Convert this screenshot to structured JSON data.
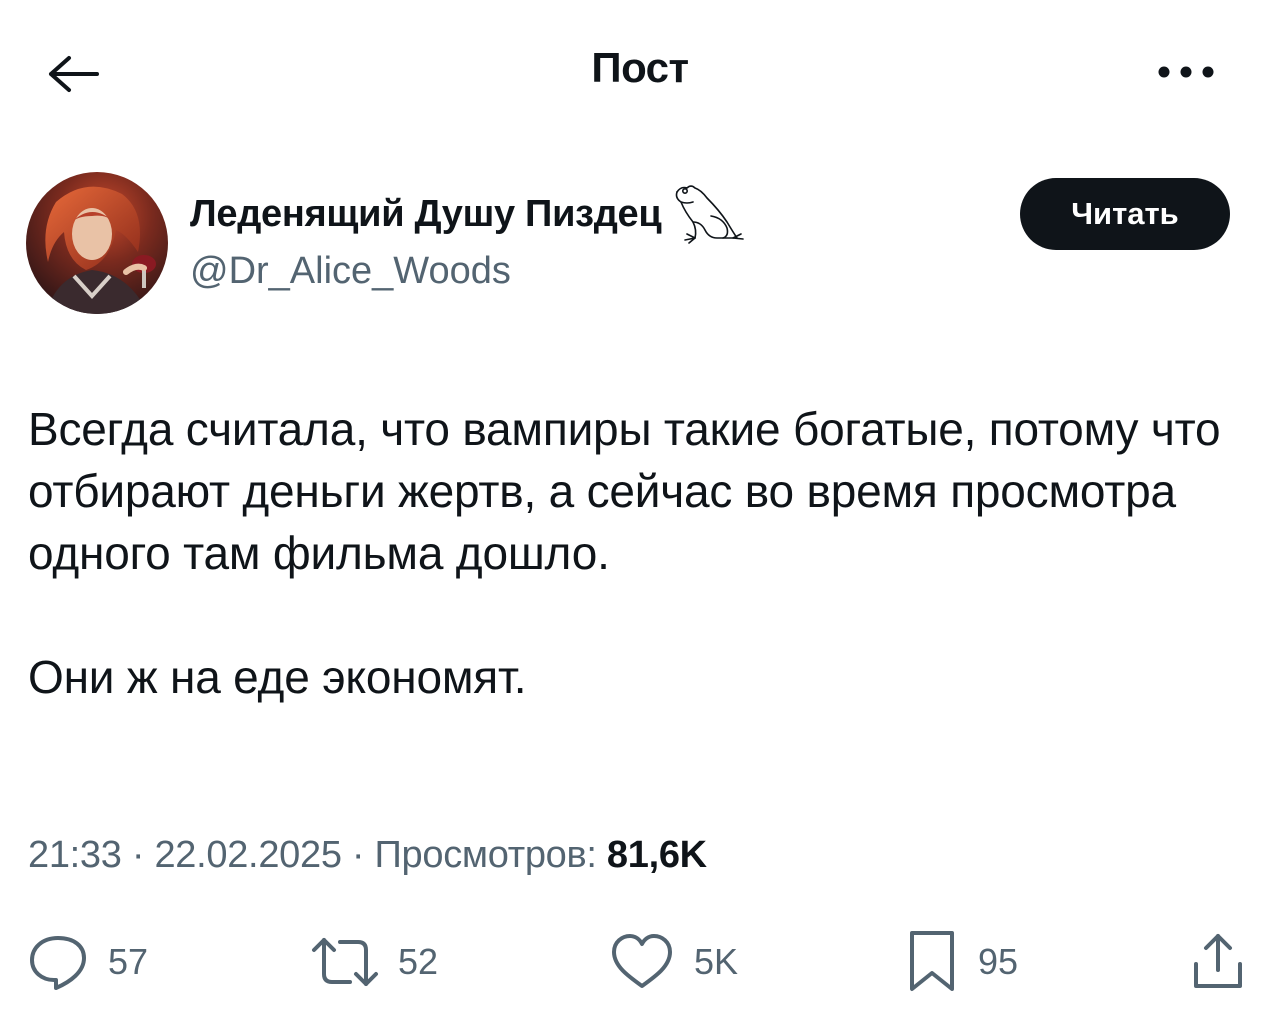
{
  "header": {
    "title": "Пост"
  },
  "author": {
    "name": "Леденящий Душу Пиздец",
    "handle": "@Dr_Alice_Woods",
    "follow_label": "Читать"
  },
  "tweet": {
    "text": "Всегда считала, что вампиры такие богатые, потому что отбирают деньги жертв, а сейчас во время просмотра одного там фильма дошло.\n\nОни ж на еде экономят."
  },
  "meta": {
    "time": "21:33",
    "date": "22.02.2025",
    "views_label": "Просмотров:",
    "views_count": "81,6K"
  },
  "actions": {
    "replies": "57",
    "reposts": "52",
    "likes": "5K",
    "bookmarks": "95"
  },
  "icons": {
    "back": "arrow-left-icon",
    "more": "more-dots-icon",
    "name_emoji": "frog-icon",
    "reply": "reply-bubble-icon",
    "repost": "repost-icon",
    "like": "heart-icon",
    "bookmark": "bookmark-icon",
    "share": "share-icon"
  }
}
